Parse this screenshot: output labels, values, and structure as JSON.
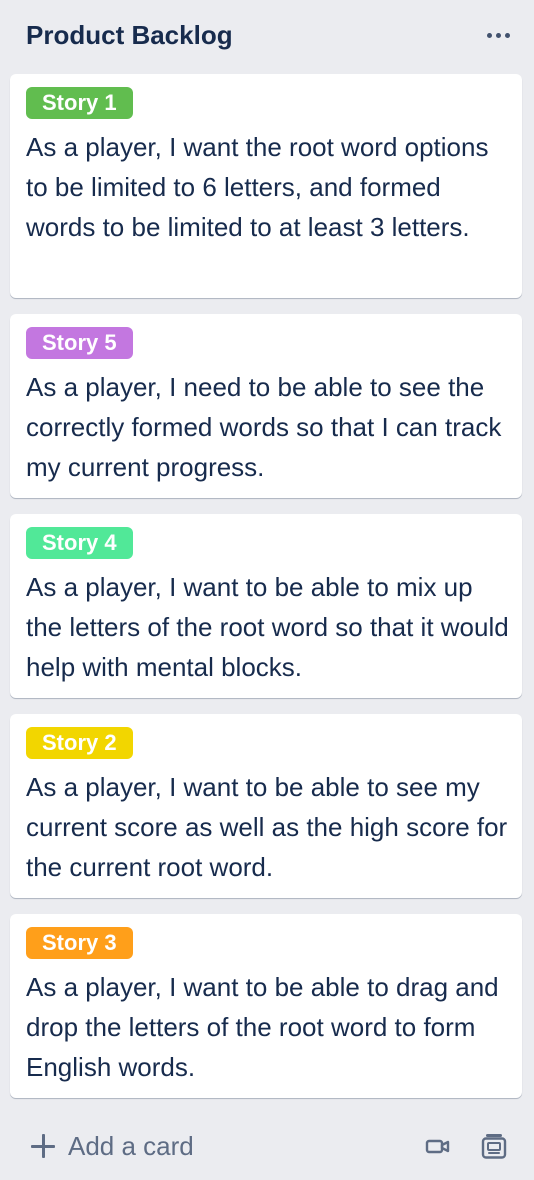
{
  "list": {
    "title": "Product Backlog",
    "menu_icon": "more-horizontal-icon",
    "cards": [
      {
        "label": "Story 1",
        "label_color": "#61bd4f",
        "text": "As a player, I want the root word options to be limited to 6 letters, and formed words to be limited to at least 3 letters."
      },
      {
        "label": "Story 5",
        "label_color": "#c377e0",
        "text": "As a player, I need to be able to see the correctly formed words so that I can track my current progress."
      },
      {
        "label": "Story 4",
        "label_color": "#51e898",
        "text": "As a player, I want to be able to mix up the letters of the root word so that it would help with mental blocks."
      },
      {
        "label": "Story 2",
        "label_color": "#f2d600",
        "text": "As a player, I want to be able to see my current score as well as the high score for the current root word."
      },
      {
        "label": "Story 3",
        "label_color": "#ff9f1a",
        "text": "As a player, I want to be able to drag and drop the letters of the root word to form English words."
      }
    ]
  },
  "footer": {
    "add_card_label": "Add a card",
    "add_icon": "plus-icon",
    "video_icon": "video-camera-icon",
    "template_icon": "card-template-icon"
  }
}
